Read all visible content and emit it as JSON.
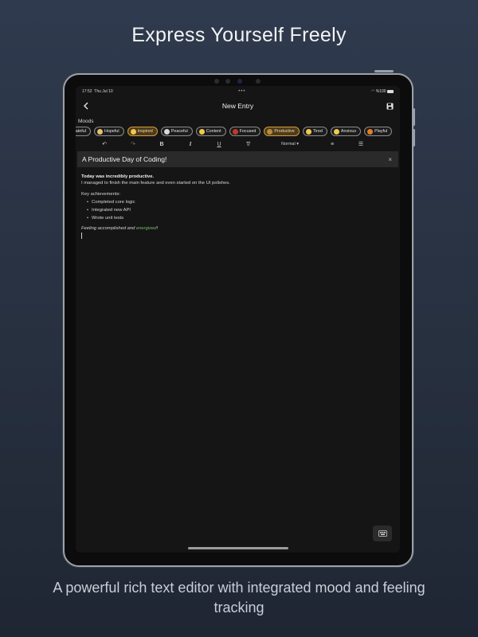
{
  "headline": "Express Yourself Freely",
  "caption": "A powerful rich text editor with integrated mood and feeling tracking",
  "status": {
    "time": "17:52",
    "date": "Thu Jul 10",
    "battery": "%100",
    "dots": "•••"
  },
  "appbar": {
    "title": "New Entry",
    "back_icon": "chevron-left-icon",
    "save_icon": "save-icon"
  },
  "moods": {
    "label": "Moods",
    "chips": [
      {
        "label": "rateful",
        "emoji": "#e0a84d",
        "selected": false
      },
      {
        "label": "Hopeful",
        "emoji": "#e6c36a",
        "selected": false
      },
      {
        "label": "Inspired",
        "emoji": "#f2c94c",
        "selected": true
      },
      {
        "label": "Peaceful",
        "emoji": "#d9d9d9",
        "selected": false
      },
      {
        "label": "Content",
        "emoji": "#f2c94c",
        "selected": false
      },
      {
        "label": "Focused",
        "emoji": "#c0392b",
        "selected": false
      },
      {
        "label": "Productive",
        "emoji": "#b88b3a",
        "selected": true
      },
      {
        "label": "Tired",
        "emoji": "#f2c94c",
        "selected": false
      },
      {
        "label": "Anxious",
        "emoji": "#f2c94c",
        "selected": false
      },
      {
        "label": "Playful",
        "emoji": "#e67e22",
        "selected": false
      }
    ]
  },
  "toolbar": {
    "undo": "↶",
    "redo": "↷",
    "bold": "B",
    "italic": "I",
    "underline": "U",
    "clear": "T̸",
    "style_select": "Normal ▾",
    "numbered_list": "≡",
    "bullet_list": "☰"
  },
  "entry": {
    "title": "A Productive Day of Coding!",
    "close": "×",
    "bold_line": "Today was incredibly productive.",
    "line2": "I managed to finish the main feature and even started on the UI polishes.",
    "achievements_label": "Key achievements:",
    "achievements": [
      "Completed core logic",
      "Integrated new API",
      "Wrote unit tests"
    ],
    "closing_italic": "Feeling accomplished and ",
    "closing_accent": "energized",
    "closing_end": "!"
  },
  "colors": {
    "accent_selected": "#d39c3a",
    "accent_green": "#73b96e",
    "background": "#151515"
  }
}
